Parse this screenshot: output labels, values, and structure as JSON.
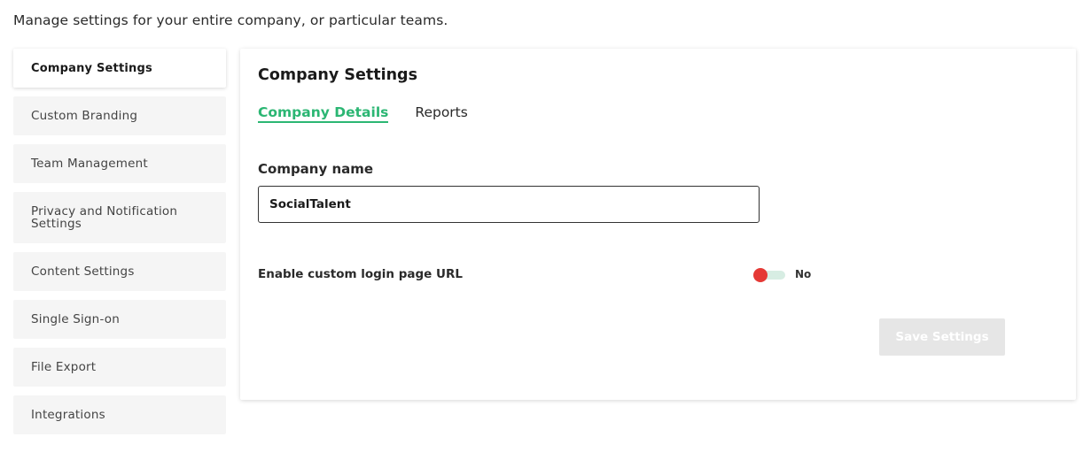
{
  "intro": "Manage settings for your entire company, or particular teams.",
  "sidebar": {
    "items": [
      {
        "label": "Company Settings",
        "active": true
      },
      {
        "label": "Custom Branding"
      },
      {
        "label": "Team Management"
      },
      {
        "label": "Privacy and Notification Settings"
      },
      {
        "label": "Content Settings"
      },
      {
        "label": "Single Sign-on"
      },
      {
        "label": "File Export"
      },
      {
        "label": "Integrations"
      }
    ]
  },
  "panel": {
    "title": "Company Settings",
    "tabs": [
      {
        "label": "Company Details",
        "active": true
      },
      {
        "label": "Reports"
      }
    ],
    "company_name": {
      "label": "Company name",
      "value": "SocialTalent"
    },
    "custom_login": {
      "label": "Enable custom login page URL",
      "state": "No",
      "enabled": false
    },
    "save_label": "Save Settings"
  },
  "colors": {
    "accent": "#2bb673",
    "toggle_off": "#e53935",
    "disabled_button": "#e6e6e6"
  }
}
